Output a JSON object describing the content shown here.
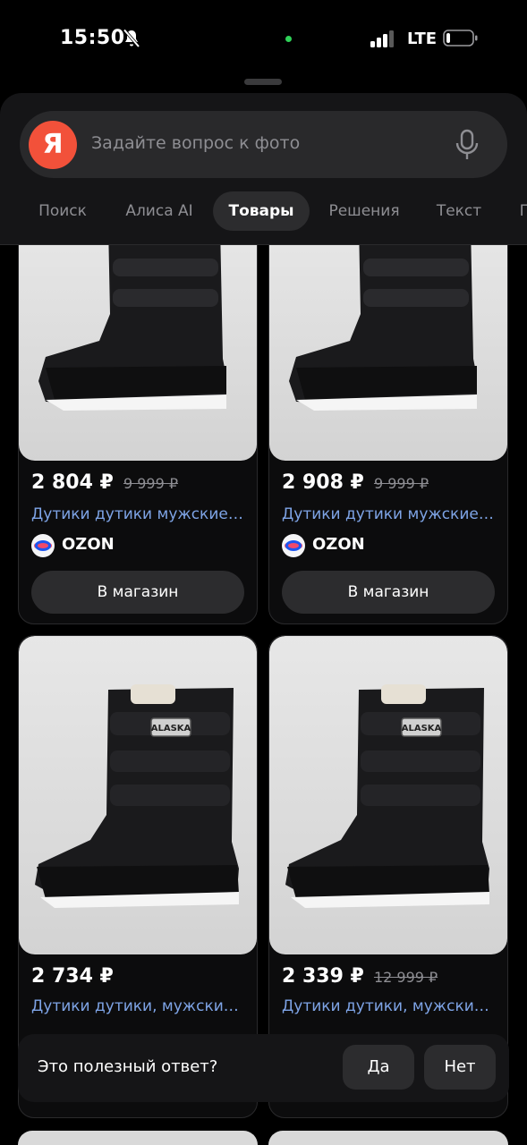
{
  "status_bar": {
    "time": "15:50",
    "network": "LTE"
  },
  "search": {
    "logo": "Я",
    "placeholder": "Задайте вопрос к фото"
  },
  "tabs": [
    {
      "label": "Поиск",
      "active": false
    },
    {
      "label": "Алиса AI",
      "active": false
    },
    {
      "label": "Товары",
      "active": true
    },
    {
      "label": "Решения",
      "active": false
    },
    {
      "label": "Текст",
      "active": false
    },
    {
      "label": "П",
      "active": false
    }
  ],
  "products": [
    {
      "price": "2 804 ₽",
      "old_price": "9 999 ₽",
      "title": "Дутики дутики мужские ...",
      "shop": "OZON",
      "button": "В магазин"
    },
    {
      "price": "2 908 ₽",
      "old_price": "9 999 ₽",
      "title": "Дутики дутики мужские ...",
      "shop": "OZON",
      "button": "В магазин"
    },
    {
      "price": "2 734 ₽",
      "old_price": "",
      "title": "Дутики дутики, мужские,...",
      "badge": "ALASKA"
    },
    {
      "price": "2 339 ₽",
      "old_price": "12 999 ₽",
      "title": "Дутики дутики, мужские,...",
      "badge": "ALASKA"
    }
  ],
  "feedback": {
    "question": "Это полезный ответ?",
    "yes": "Да",
    "no": "Нет"
  },
  "colors": {
    "accent": "#f2513a",
    "link": "#7ea4e6",
    "background": "#000000"
  },
  "icons": [
    "bell-off-icon",
    "signal-icon",
    "battery-icon",
    "mic-icon",
    "ozon-logo-icon"
  ]
}
